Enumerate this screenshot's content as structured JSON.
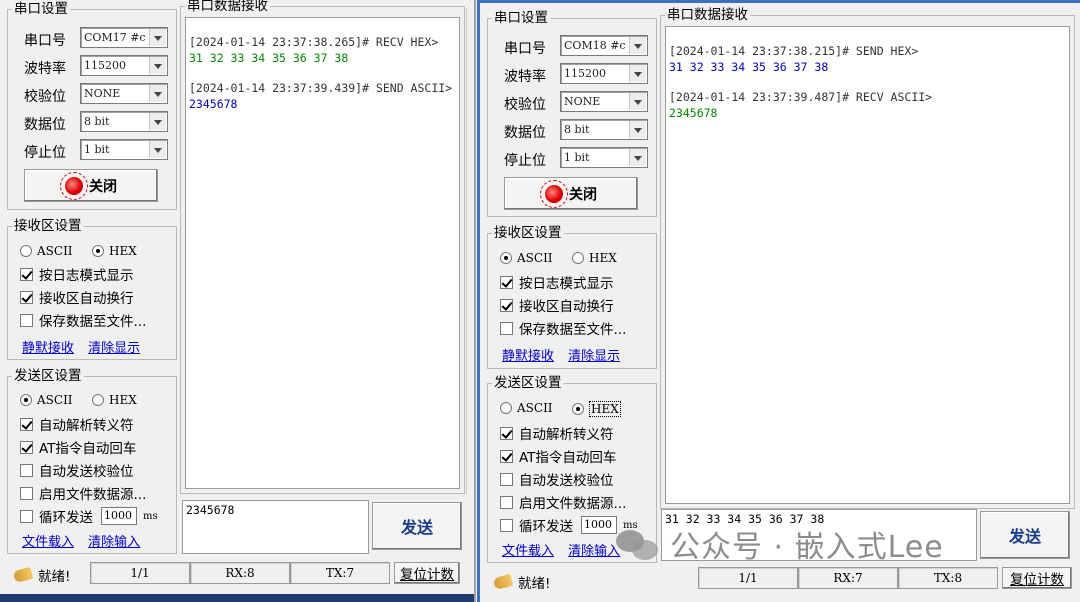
{
  "left": {
    "port_group_title": "串口设置",
    "fields": [
      {
        "label": "串口号",
        "value": "COM17 #c"
      },
      {
        "label": "波特率",
        "value": "115200"
      },
      {
        "label": "校验位",
        "value": "NONE"
      },
      {
        "label": "数据位",
        "value": "8 bit"
      },
      {
        "label": "停止位",
        "value": "1 bit"
      }
    ],
    "close_label": "关闭",
    "rx_settings_title": "接收区设置",
    "rx_mode": {
      "ascii": "ASCII",
      "hex": "HEX",
      "selected": "HEX"
    },
    "rx_options": [
      {
        "label": "按日志模式显示",
        "checked": true
      },
      {
        "label": "接收区自动换行",
        "checked": true
      },
      {
        "label": "保存数据至文件...",
        "checked": false
      }
    ],
    "rx_links": {
      "a": "静默接收",
      "b": "清除显示"
    },
    "tx_settings_title": "发送区设置",
    "tx_mode": {
      "ascii": "ASCII",
      "hex": "HEX",
      "selected": "ASCII"
    },
    "tx_options": [
      {
        "label": "自动解析转义符",
        "checked": true
      },
      {
        "label": "AT指令自动回车",
        "checked": true
      },
      {
        "label": "自动发送校验位",
        "checked": false
      },
      {
        "label": "启用文件数据源...",
        "checked": false
      }
    ],
    "loop_label": "循环发送",
    "loop_value": "1000",
    "loop_unit": "ms",
    "tx_links": {
      "a": "文件载入",
      "b": "清除输入"
    },
    "rx_title": "串口数据接收",
    "rx_log": [
      {
        "ts": "[2024-01-14 23:37:38.265]# RECV HEX>",
        "data": "31 32 33 34 35 36 37 38",
        "color": "#008800"
      },
      {
        "ts": "[2024-01-14 23:37:39.439]# SEND ASCII>",
        "data": "2345678",
        "color": "#0000cc"
      }
    ],
    "tx_text": "2345678",
    "send_label": "发送",
    "status": {
      "ready": "就绪!",
      "page": "1/1",
      "rx": "RX:8",
      "tx": "TX:7",
      "reset": "复位计数"
    }
  },
  "right": {
    "port_group_title": "串口设置",
    "fields": [
      {
        "label": "串口号",
        "value": "COM18 #c"
      },
      {
        "label": "波特率",
        "value": "115200"
      },
      {
        "label": "校验位",
        "value": "NONE"
      },
      {
        "label": "数据位",
        "value": "8 bit"
      },
      {
        "label": "停止位",
        "value": "1 bit"
      }
    ],
    "close_label": "关闭",
    "rx_settings_title": "接收区设置",
    "rx_mode": {
      "ascii": "ASCII",
      "hex": "HEX",
      "selected": "ASCII"
    },
    "rx_options": [
      {
        "label": "按日志模式显示",
        "checked": true
      },
      {
        "label": "接收区自动换行",
        "checked": true
      },
      {
        "label": "保存数据至文件...",
        "checked": false
      }
    ],
    "rx_links": {
      "a": "静默接收",
      "b": "清除显示"
    },
    "tx_settings_title": "发送区设置",
    "tx_mode": {
      "ascii": "ASCII",
      "hex": "HEX",
      "selected": "HEX"
    },
    "tx_options": [
      {
        "label": "自动解析转义符",
        "checked": true
      },
      {
        "label": "AT指令自动回车",
        "checked": true
      },
      {
        "label": "自动发送校验位",
        "checked": false
      },
      {
        "label": "启用文件数据源...",
        "checked": false
      }
    ],
    "loop_label": "循环发送",
    "loop_value": "1000",
    "loop_unit": "ms",
    "tx_links": {
      "a": "文件载入",
      "b": "清除输入"
    },
    "rx_title": "串口数据接收",
    "rx_log": [
      {
        "ts": "[2024-01-14 23:37:38.215]# SEND HEX>",
        "data": "31 32 33 34 35 36 37 38",
        "color": "#0000cc"
      },
      {
        "ts": "[2024-01-14 23:37:39.487]# RECV ASCII>",
        "data": "2345678",
        "color": "#008800"
      }
    ],
    "tx_text": "31 32 33 34 35 36 37 38",
    "send_label": "发送",
    "status": {
      "ready": "就绪!",
      "page": "1/1",
      "rx": "RX:7",
      "tx": "TX:8",
      "reset": "复位计数"
    }
  },
  "watermark": "公众号 · 嵌入式Lee"
}
